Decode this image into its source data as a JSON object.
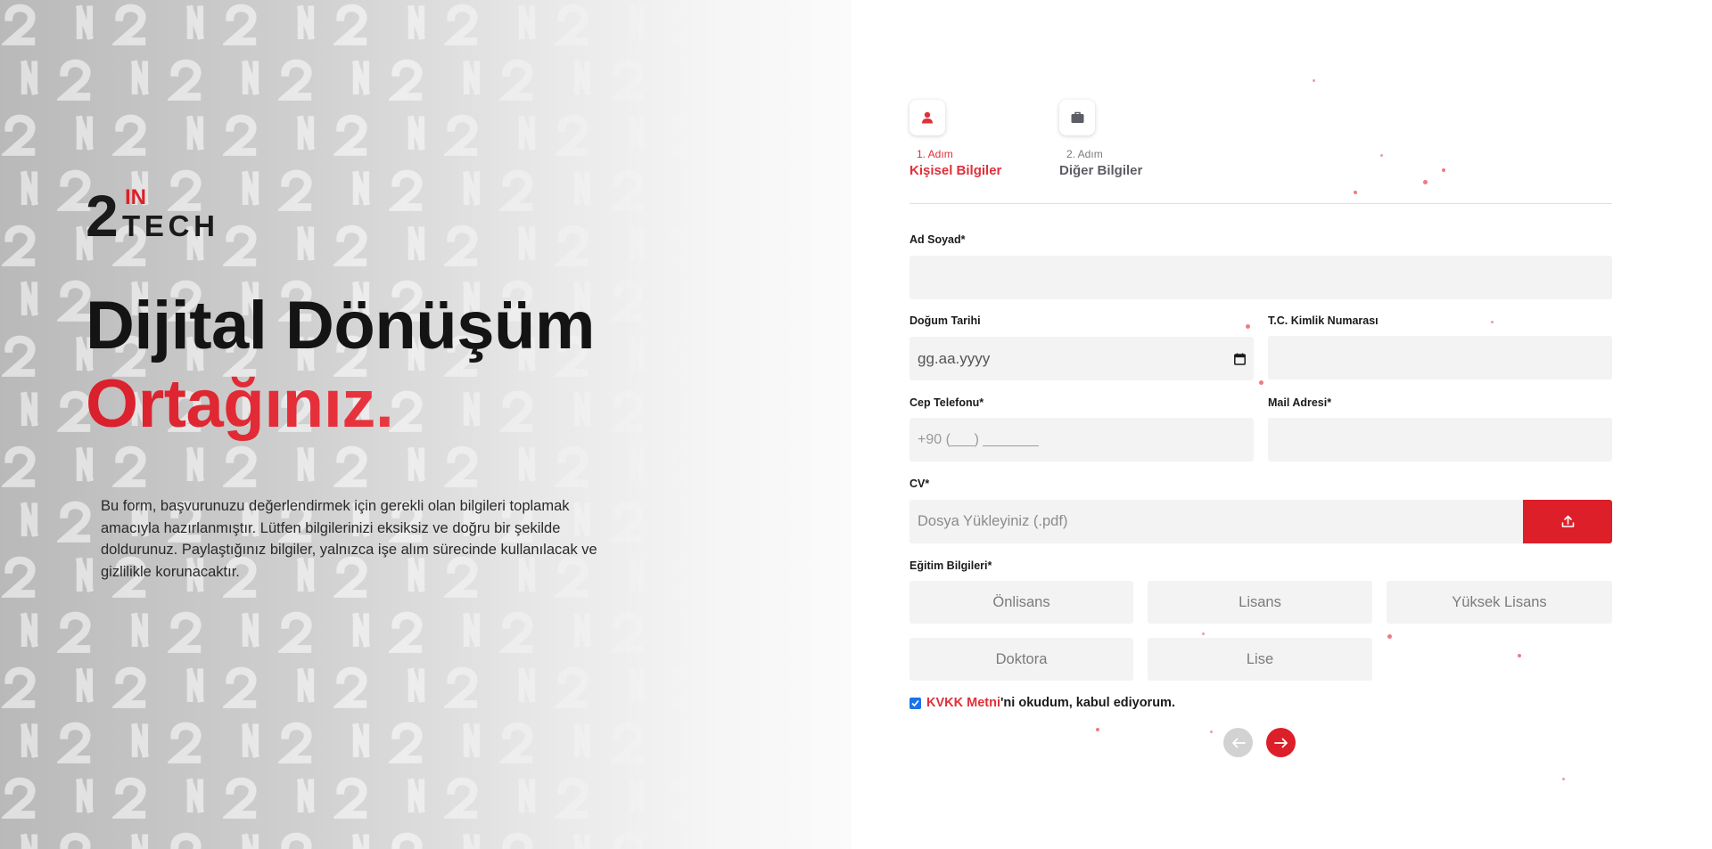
{
  "brand": {
    "logo_text_top": "IN",
    "logo_text_bottom": "TECH",
    "logo_number": "2",
    "accent_color": "#dc1f28"
  },
  "hero": {
    "headline_line1": "Dijital Dönüşüm",
    "headline_line2": "Ortağınız.",
    "intro": "Bu form, başvurunuzu değerlendirmek için gerekli olan bilgileri toplamak amacıyla hazırlanmıştır. Lütfen bilgilerinizi eksiksiz ve doğru bir şekilde doldurunuz. Paylaştığınız bilgiler, yalnızca işe alım sürecinde kullanılacak ve gizlilikle korunacaktır."
  },
  "steps": [
    {
      "number": "1. Adım",
      "title": "Kişisel Bilgiler",
      "icon": "user-icon",
      "active": true
    },
    {
      "number": "2. Adım",
      "title": "Diğer Bilgiler",
      "icon": "briefcase-icon",
      "active": false
    }
  ],
  "form": {
    "full_name": {
      "label": "Ad Soyad*",
      "value": ""
    },
    "birth_date": {
      "label": "Doğum Tarihi",
      "placeholder": "gg.aa.yyyy"
    },
    "tc_number": {
      "label": "T.C. Kimlik Numarası",
      "value": ""
    },
    "phone": {
      "label": "Cep Telefonu*",
      "placeholder": "+90 (___) _______"
    },
    "email": {
      "label": "Mail Adresi*",
      "value": ""
    },
    "cv": {
      "label": "CV*",
      "placeholder": "Dosya Yükleyiniz (.pdf)",
      "button_icon": "upload-icon"
    },
    "education": {
      "label": "Eğitim Bilgileri*",
      "options": [
        "Önlisans",
        "Lisans",
        "Yüksek Lisans",
        "Doktora",
        "Lise"
      ]
    },
    "consent": {
      "link_text": "KVKK Metni",
      "rest_text": "'ni okudum, kabul ediyorum.",
      "checked": true
    }
  },
  "navigation": {
    "prev_icon": "arrow-left-icon",
    "next_icon": "arrow-right-icon"
  }
}
